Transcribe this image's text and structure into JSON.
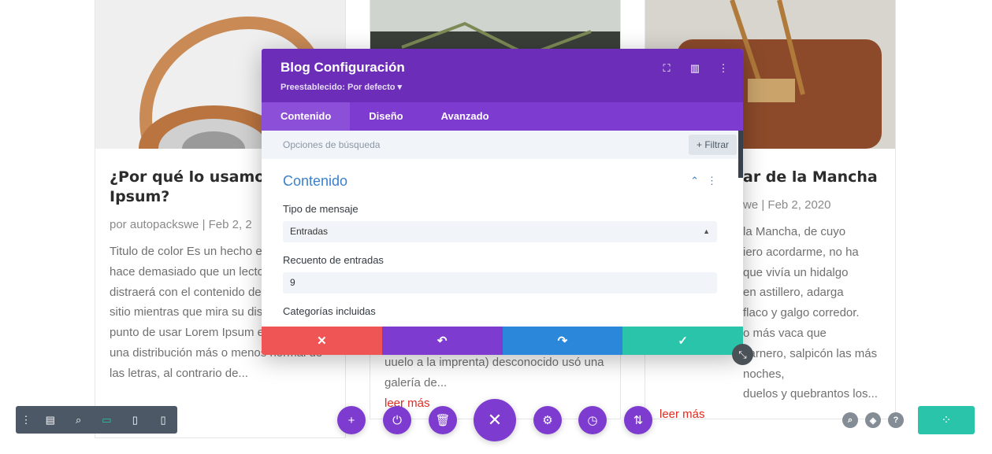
{
  "cards": [
    {
      "title": "¿Por qué lo usamo\nIpsum?",
      "meta": "por autopackswe | Feb 2, 2",
      "excerpt": "Titulo de color Es un hecho establecido hace demasiado que un lector se distraerá con el contenido del texto de un sitio mientras que mira su diseño. El punto de usar Lorem Ipsum es que tiene una distribución más o menos normal de las letras, al contrario de...",
      "more": ""
    },
    {
      "title": "",
      "meta": "",
      "excerpt": "uuelo a la imprenta) desconocido usó una galería de...",
      "more": "leer más"
    },
    {
      "title": "ar de la Mancha",
      "meta": "we | Feb 2, 2020",
      "excerpt": "la Mancha, de cuyo\niero acordarme, no ha\nque vivía un hidalgo\nen astillero, adarga\nflaco y galgo corredor.\no más vaca que\ncarnero, salpicón las más noches,\nduelos y quebrantos los...",
      "more": "leer más"
    }
  ],
  "modal": {
    "title": "Blog Configuración",
    "preset": "Preestablecido: Por defecto ▾",
    "tabs": [
      {
        "label": "Contenido",
        "active": true
      },
      {
        "label": "Diseño",
        "active": false
      },
      {
        "label": "Avanzado",
        "active": false
      }
    ],
    "search_placeholder": "Opciones de búsqueda",
    "filter_label": "+ Filtrar",
    "section_title": "Contenido",
    "fields": {
      "post_type_label": "Tipo de mensaje",
      "post_type_value": "Entradas",
      "post_count_label": "Recuento de entradas",
      "post_count_value": "9",
      "categories_label": "Categorías incluidas"
    }
  },
  "icons": {
    "close": "✕",
    "undo": "↶",
    "redo": "↷",
    "check": "✓"
  },
  "colors": {
    "purple_header": "#6c2eb9",
    "purple_tabs": "#7e3bd0",
    "red": "#ef5555",
    "blue": "#2b87da",
    "teal": "#29c4a9",
    "link_red": "#e02b20",
    "section_blue": "#3c80c9"
  }
}
